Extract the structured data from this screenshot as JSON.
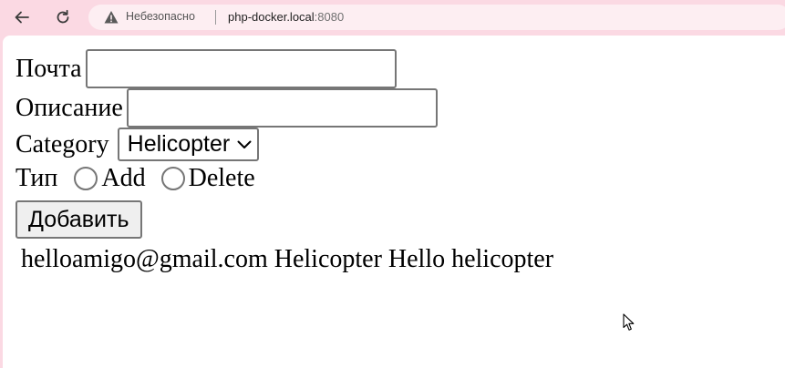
{
  "browser": {
    "security_label": "Небезопасно",
    "url_host": "php-docker.local",
    "url_port": ":8080"
  },
  "form": {
    "email_label": "Почта",
    "email_value": "",
    "description_label": "Описание",
    "description_value": "",
    "category_label": "Category",
    "category_selected": "Helicopter",
    "type_label": "Тип",
    "type_options": [
      "Add",
      "Delete"
    ],
    "submit_label": "Добавить"
  },
  "results": {
    "entry": "helloamigo@gmail.com Helicopter Hello helicopter"
  },
  "icons": {
    "back": "arrow-left-icon",
    "reload": "reload-icon",
    "security": "warning-triangle-icon",
    "dropdown": "chevron-down-icon",
    "cursor": "mouse-pointer-icon"
  },
  "colors": {
    "chrome_bg": "#fbd9e3",
    "omnibox_bg": "#fdeef2",
    "page_bg": "#ffffff",
    "control_border": "#767676",
    "button_bg": "#efefef"
  }
}
